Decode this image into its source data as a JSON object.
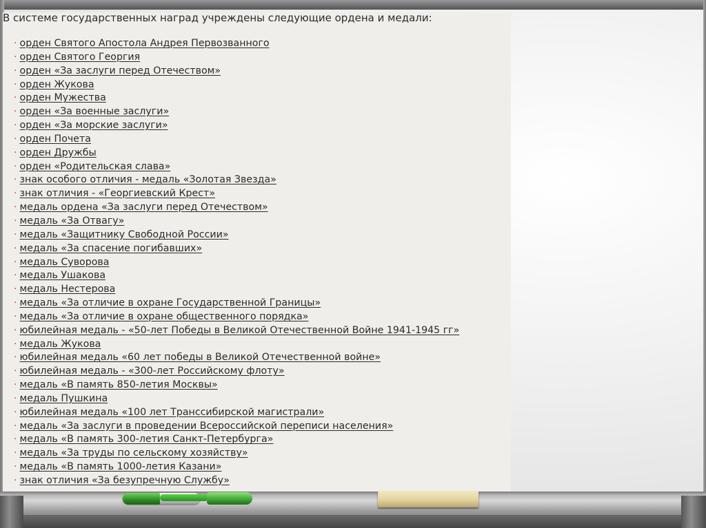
{
  "heading": "В системе государственных наград учреждены следующие ордена и медали:",
  "awards": [
    "орден Святого Апостола Андрея Первозванного",
    "орден Святого Георгия",
    "орден «За заслуги перед Отечеством»",
    "орден Жукова",
    "орден Мужества",
    "орден «За военные заслуги»",
    "орден «За морские заслуги»",
    "орден Почета",
    "орден Дружбы",
    "орден «Родительская слава»",
    "знак особого отличия - медаль «Золотая Звезда»",
    "знак отличия - «Георгиевский Крест»",
    "медаль ордена «За заслуги перед Отечеством»",
    "медаль «За Отвагу»",
    "медаль «Защитнику Свободной России»",
    "медаль «За спасение погибавших»",
    "медаль Суворова",
    "медаль Ушакова",
    "медаль Нестерова",
    "медаль «За отличие в охране Государственной Границы»",
    "медаль «За отличие в охране общественного порядка»",
    "юбилейная медаль - «50-лет Победы в Великой Отечественной Войне 1941-1945 гг»",
    "медаль Жукова",
    "юбилейная медаль «60 лет победы в Великой Отечественной войне»",
    "юбилейная медаль - «300-лет Российскому флоту»",
    "медаль «В память 850-летия Москвы»",
    "медаль Пушкина",
    "юбилейная медаль «100 лет Транссибирской магистрали»",
    "медаль «За заслуги в проведении Всероссийской переписи населения»",
    "медаль «В память 300-летия Санкт-Петербурга»",
    "медаль «За труды по сельскому хозяйству»",
    "медаль «В память 1000-летия Казани»",
    "знак отличия «За безупречную Службу»"
  ],
  "bullet": "·"
}
